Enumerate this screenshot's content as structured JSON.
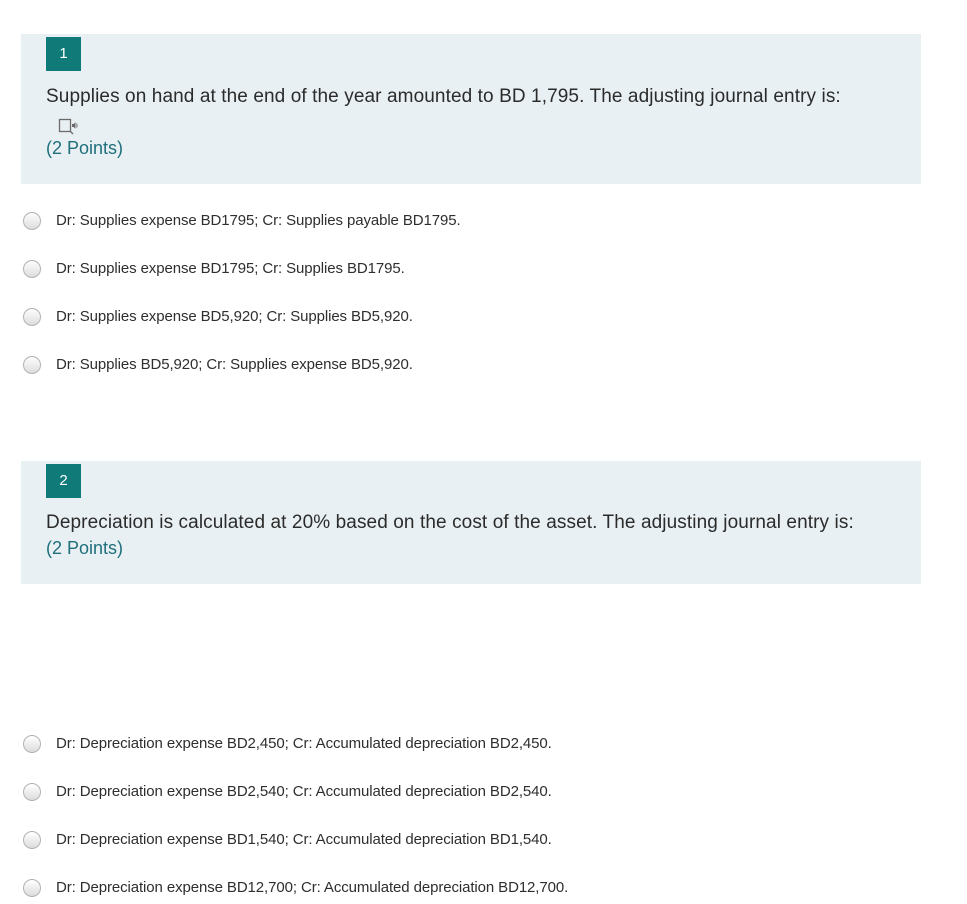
{
  "questions": [
    {
      "number": "1",
      "text": "Supplies on hand  at the end of the year amounted to BD 1,795. The adjusting journal entry is:",
      "points": "(2 Points)",
      "icon": "immersive-reader-icon",
      "options": [
        "Dr: Supplies expense BD1795; Cr: Supplies payable BD1795.",
        "Dr: Supplies expense BD1795; Cr: Supplies BD1795.",
        "Dr: Supplies expense BD5,920; Cr: Supplies BD5,920.",
        "Dr: Supplies BD5,920; Cr: Supplies expense BD5,920."
      ]
    },
    {
      "number": "2",
      "text": "Depreciation is calculated at 20% based on the cost of the asset. The adjusting journal entry is:",
      "points": "(2 Points)",
      "options": [
        "Dr: Depreciation expense BD2,450; Cr: Accumulated depreciation BD2,450.",
        "Dr: Depreciation expense BD2,540; Cr: Accumulated depreciation BD2,540.",
        "Dr: Depreciation expense BD1,540; Cr: Accumulated depreciation BD1,540.",
        "Dr: Depreciation expense BD12,700; Cr: Accumulated depreciation BD12,700."
      ]
    }
  ],
  "colors": {
    "accent": "#0f7a78",
    "header_bg": "#e8f0f3",
    "points_text": "#1f6f7d"
  }
}
